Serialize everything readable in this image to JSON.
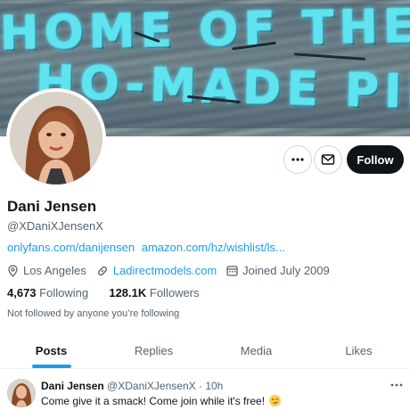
{
  "banner": {
    "line1": "HOME OF THE",
    "line2": "HO-MADE PIES"
  },
  "actions": {
    "more_icon": "more-horizontal-icon",
    "message_icon": "mail-icon",
    "follow_label": "Follow"
  },
  "profile": {
    "name": "Dani Jensen",
    "handle": "@XDaniXJensenX",
    "links": [
      "onlyfans.com/danijensen",
      "amazon.com/hz/wishlist/ls..."
    ],
    "location": "Los Angeles",
    "website": "Ladirectmodels.com",
    "joined": "Joined July 2009",
    "following_count": "4,673",
    "following_label": "Following",
    "followers_count": "128.1K",
    "followers_label": "Followers",
    "not_followed_text": "Not followed by anyone you’re following"
  },
  "tabs": [
    {
      "label": "Posts",
      "active": true
    },
    {
      "label": "Replies",
      "active": false
    },
    {
      "label": "Media",
      "active": false
    },
    {
      "label": "Likes",
      "active": false
    }
  ],
  "tweet": {
    "author": "Dani Jensen",
    "handle": "@XDaniXJensenX",
    "separator": "·",
    "time": "10h",
    "text": "Come give it a smack! Come join while it's free!",
    "emoji": "smirk-emoji"
  },
  "colors": {
    "accent": "#1d9bf0",
    "text": "#0f1419",
    "secondary": "#536471",
    "neon": "#5fe3ee"
  }
}
